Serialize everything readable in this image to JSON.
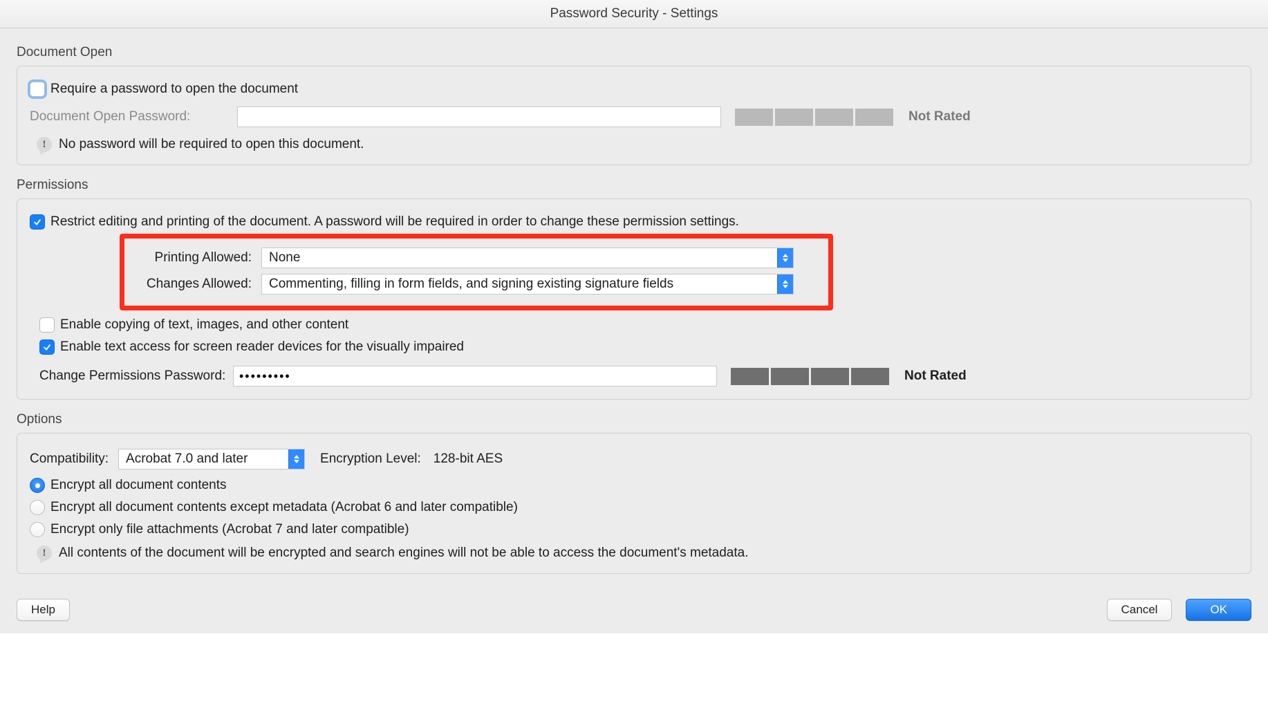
{
  "window_title": "Password Security - Settings",
  "document_open": {
    "title": "Document Open",
    "require_password_label": "Require a password to open the document",
    "require_password_checked": false,
    "password_label": "Document Open Password:",
    "password_value": "",
    "strength_text": "Not Rated",
    "info_text": "No password will be required to open this document."
  },
  "permissions": {
    "title": "Permissions",
    "restrict_label": "Restrict editing and printing of the document. A password will be required in order to change these permission settings.",
    "restrict_checked": true,
    "printing_label": "Printing Allowed:",
    "printing_value": "None",
    "changes_label": "Changes Allowed:",
    "changes_value": "Commenting, filling in form fields, and signing existing signature fields",
    "copy_label": "Enable copying of text, images, and other content",
    "copy_checked": false,
    "screenreader_label": "Enable text access for screen reader devices for the visually impaired",
    "screenreader_checked": true,
    "perm_password_label": "Change Permissions Password:",
    "perm_password_value": "•••••••••",
    "strength_text": "Not Rated"
  },
  "options": {
    "title": "Options",
    "compatibility_label": "Compatibility:",
    "compatibility_value": "Acrobat 7.0 and later",
    "encryption_label": "Encryption  Level:",
    "encryption_value": "128-bit AES",
    "radio1": "Encrypt all document contents",
    "radio2": "Encrypt all document contents except metadata (Acrobat 6 and later compatible)",
    "radio3": "Encrypt only file attachments (Acrobat 7 and later compatible)",
    "info_text": "All contents of the document will be encrypted and search engines will not be able to access the document's metadata."
  },
  "footer": {
    "help": "Help",
    "cancel": "Cancel",
    "ok": "OK"
  }
}
